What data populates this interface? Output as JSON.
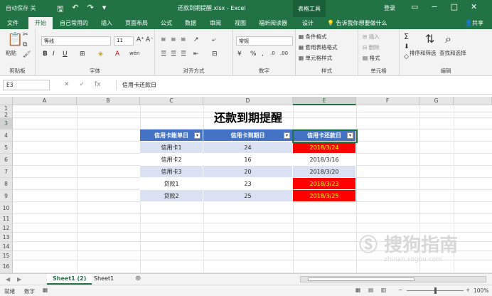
{
  "titlebar": {
    "autosave": "自动保存",
    "autosave_state": "关",
    "doc_title": "还款到期提醒.xlsx - Excel",
    "table_tools": "表格工具",
    "login": "登录"
  },
  "tabs": [
    "文件",
    "开始",
    "自己常用的",
    "插入",
    "页面布局",
    "公式",
    "数据",
    "审阅",
    "视图",
    "福昕阅读器",
    "设计"
  ],
  "active_tab": "开始",
  "tellme": "告诉我你想要做什么",
  "share": "共享",
  "ribbon": {
    "clipboard": {
      "paste": "粘贴",
      "label": "剪贴板"
    },
    "font": {
      "name": "等线",
      "size": "11",
      "bold": "B",
      "italic": "I",
      "underline": "U",
      "wen": "wén",
      "label": "字体"
    },
    "align": {
      "label": "对齐方式"
    },
    "number": {
      "format": "常规",
      "percent": "%",
      "comma": ",",
      "label": "数字"
    },
    "styles": {
      "cond": "条件格式",
      "table": "套用表格格式",
      "cell": "单元格样式",
      "label": "样式"
    },
    "cells": {
      "insert": "插入",
      "delete": "删除",
      "format": "格式",
      "label": "单元格"
    },
    "editing": {
      "sort": "排序和筛选",
      "find": "查找和选择",
      "label": "编辑"
    }
  },
  "formula_bar": {
    "name_box": "E3",
    "fx": "fx",
    "content": "信用卡还款日"
  },
  "columns": [
    "A",
    "B",
    "C",
    "D",
    "E",
    "F",
    "G"
  ],
  "rows": [
    "1",
    "2",
    "3",
    "4",
    "5",
    "6",
    "7",
    "8",
    "9",
    "10",
    "11",
    "12",
    "13",
    "14",
    "15",
    "16"
  ],
  "sheet_title": "还款到期提醒",
  "table": {
    "headers": [
      "信用卡账单日",
      "信用卡到期日",
      "信用卡还款日"
    ],
    "rows": [
      {
        "name": "信用卡1",
        "due": "24",
        "pay": "2018/3/24",
        "overdue": true
      },
      {
        "name": "信用卡2",
        "due": "16",
        "pay": "2018/3/16",
        "overdue": false
      },
      {
        "name": "信用卡3",
        "due": "20",
        "pay": "2018/3/20",
        "overdue": false
      },
      {
        "name": "贷款1",
        "due": "23",
        "pay": "2018/3/23",
        "overdue": true
      },
      {
        "name": "贷款2",
        "due": "25",
        "pay": "2018/3/25",
        "overdue": true
      }
    ]
  },
  "sheets": [
    "Sheet1 (2)",
    "Sheet1"
  ],
  "active_sheet": "Sheet1 (2)",
  "status": {
    "ready": "就绪",
    "mode": "数字",
    "zoom": "100%"
  },
  "watermark": {
    "brand": "搜狗指南",
    "site": "zhinan.sogou.com"
  },
  "colors": {
    "excel_green": "#217346",
    "header_blue": "#4472c4",
    "band_blue": "#d9e1f2",
    "alert_red": "#ff0000",
    "alert_text": "#ffff00"
  }
}
